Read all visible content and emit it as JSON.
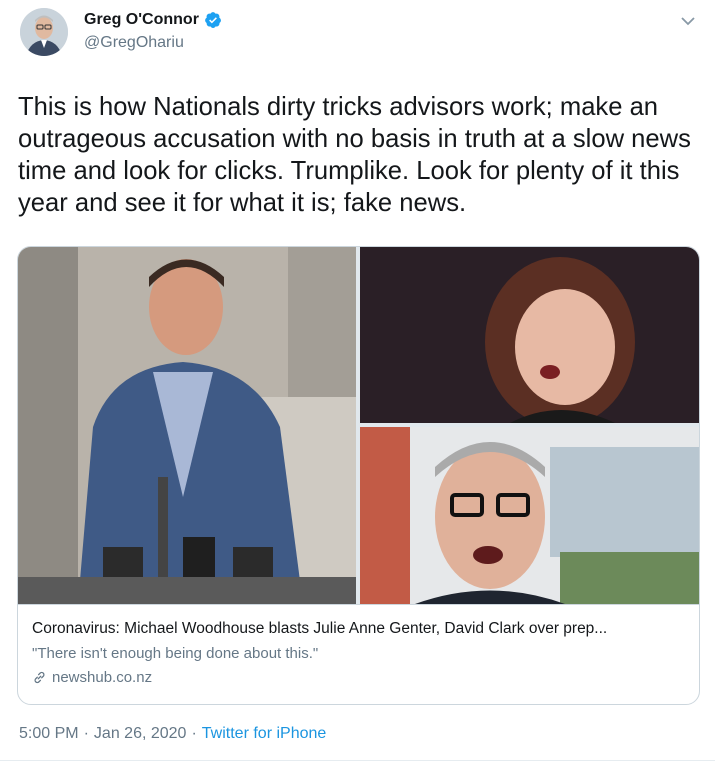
{
  "author": {
    "name": "Greg O'Connor",
    "handle": "@GregOhariu",
    "verified_icon": "verified-badge-icon",
    "verified_color": "#1da1f2"
  },
  "tweet": {
    "text": "This is how Nationals dirty tricks advisors work; make an outrageous accusation with no basis in truth at a slow news time and look for clicks. Trumplike. Look for plenty of it this year and see it for what it is; fake news."
  },
  "card": {
    "title": "Coronavirus: Michael Woodhouse blasts Julie Anne Genter, David Clark over prep...",
    "description": "\"There isn't enough being done about this.\"",
    "domain": "newshub.co.nz",
    "domain_icon": "link-icon"
  },
  "meta": {
    "time": "5:00 PM",
    "date": "Jan 26, 2020",
    "separator": "·",
    "source": "Twitter for iPhone"
  },
  "colors": {
    "text": "#14171a",
    "secondary": "#657786",
    "link": "#1b95e0",
    "border": "#ccd6dd"
  }
}
